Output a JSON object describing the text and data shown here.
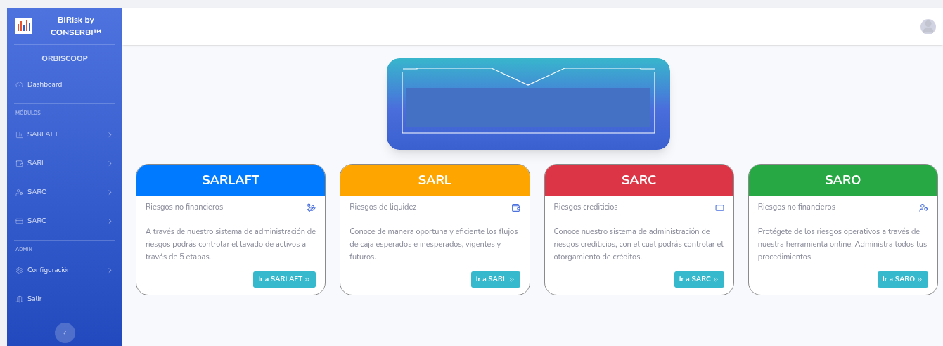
{
  "sidebar": {
    "brand": "BIRisk by CONSERBI™",
    "org": "ORBISCOOP",
    "sections": [
      {
        "items": [
          {
            "label": "Dashboard",
            "kind": "gauge",
            "submenu": false
          }
        ]
      },
      {
        "heading": "MÓDULOS",
        "items": [
          {
            "label": "SARLAFT",
            "kind": "chart",
            "submenu": true
          },
          {
            "label": "SARL",
            "kind": "wallet",
            "submenu": true
          },
          {
            "label": "SARO",
            "kind": "user-shield",
            "submenu": true
          },
          {
            "label": "SARC",
            "kind": "card",
            "submenu": true
          }
        ]
      },
      {
        "heading": "ADMIN",
        "items": [
          {
            "label": "Configuración",
            "kind": "gear",
            "submenu": true
          },
          {
            "label": "Salir",
            "kind": "door",
            "submenu": false
          }
        ]
      }
    ]
  },
  "cards": [
    {
      "title": "SARLAFT",
      "color": "#007bff",
      "subtitle": "Riesgos no financieros",
      "kind": "hand-coin",
      "text": "A través de nuestro sistema de administración de riesgos podrás controlar el lavado de activos a través de 5 etapas.",
      "button": "Ir a SARLAFT"
    },
    {
      "title": "SARL",
      "color": "#ffa500",
      "subtitle": "Riesgos de liquidez",
      "kind": "wallet",
      "text": "Conoce de manera oportuna y eficiente los flujos de caja esperados e inesperados, vigentes y futuros.",
      "button": "Ir a SARL"
    },
    {
      "title": "SARC",
      "color": "#dc3545",
      "subtitle": "Riesgos crediticios",
      "kind": "card",
      "text": "Conoce nuestro sistema de administración de riesgos crediticios, con el cual podrás controlar el otorgamiento de créditos.",
      "button": "Ir a SARC"
    },
    {
      "title": "SARO",
      "color": "#28a745",
      "subtitle": "Riesgos no financieros",
      "kind": "user-shield",
      "text": "Protégete de los riesgos operativos a través de nuestra herramienta online. Administra todos tus procedimientos.",
      "button": "Ir a SARO"
    }
  ]
}
